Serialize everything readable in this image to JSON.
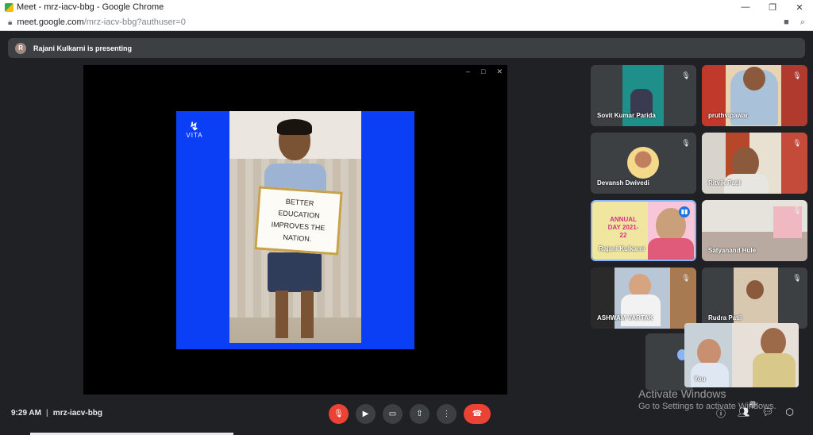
{
  "browser": {
    "title": "Meet - mrz-iacv-bbg - Google Chrome",
    "url_host": "meet.google.com",
    "url_path": "/mrz-iacv-bbg?authuser=0",
    "minimize": "—",
    "restore": "❐",
    "close": "✕"
  },
  "banner": {
    "avatar_letter": "R",
    "text": "Rajani Kulkarni is presenting"
  },
  "presentation": {
    "logo_text": "VITA",
    "sign_lines": [
      "BETTER",
      "EDUCATION",
      "IMPROVES THE",
      "NATION."
    ]
  },
  "participants": [
    {
      "name": "Sovit Kumar Parida",
      "muted": true
    },
    {
      "name": "pruthvipawar",
      "muted": true
    },
    {
      "name": "Devansh Dwivedi",
      "muted": true
    },
    {
      "name": "Ritvik Patil",
      "muted": true
    },
    {
      "name": "Rajani Kulkarni",
      "muted": false,
      "speaking": true,
      "annual_label": "ANNUAL DAY 2021-22"
    },
    {
      "name": "Satyanand Hule",
      "muted": true
    },
    {
      "name": "ASHWAM VARTAK",
      "muted": true
    },
    {
      "name": "Rudra Patil",
      "muted": true
    }
  ],
  "self_view": {
    "name": "You"
  },
  "meeting": {
    "time": "9:29 AM",
    "separator": "|",
    "code": "mrz-iacv-bbg",
    "people_count": "20"
  },
  "watermark": {
    "line1": "Activate Windows",
    "line2": "Go to Settings to activate Windows."
  },
  "colors": {
    "background": "#202124",
    "tile": "#3c4043",
    "end_call": "#ea4335",
    "slide_blue": "#0a3ff5"
  }
}
